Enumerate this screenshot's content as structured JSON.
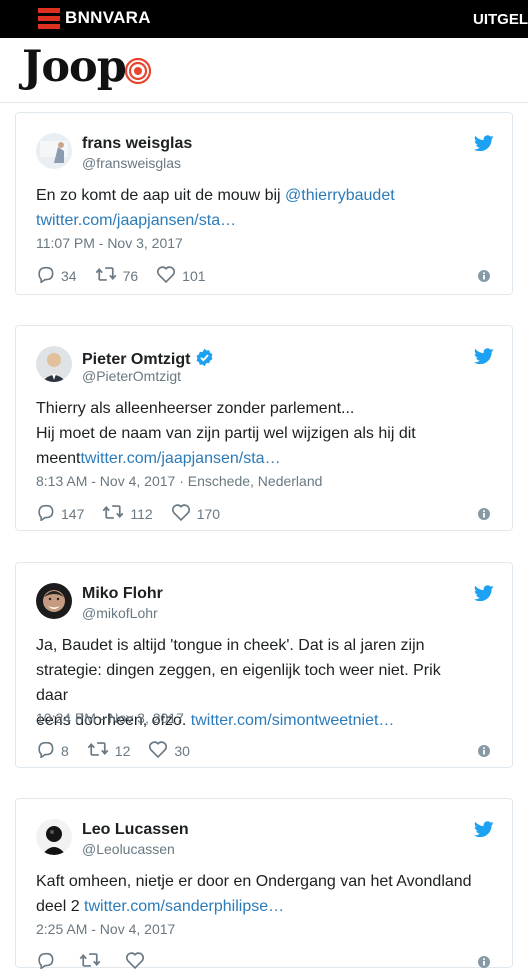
{
  "header": {
    "brand": "BNNVARA",
    "nav_label": "UITGELI",
    "site_logo": "Joop"
  },
  "tweets": [
    {
      "name": "frans weisglas",
      "handle": "@fransweisglas",
      "verified": false,
      "lines": [
        [
          {
            "t": "En zo komt de aap uit de mouw bij "
          },
          {
            "t": "@thierrybaudet",
            "link": true
          }
        ],
        [
          {
            "t": "twitter.com/jaapjansen/sta…",
            "link": true
          }
        ]
      ],
      "time": "11:07 PM - Nov 3, 2017",
      "replies": "34",
      "retweets": "76",
      "likes": "101"
    },
    {
      "name": "Pieter Omtzigt",
      "handle": "@PieterOmtzigt",
      "verified": true,
      "lines": [
        [
          {
            "t": "Thierry als alleenheerser zonder parlement..."
          }
        ],
        [
          {
            "t": "Hij moet de naam van zijn partij wel wijzigen als hij dit"
          }
        ],
        [
          {
            "t": "meent"
          },
          {
            "t": "twitter.com/jaapjansen/sta…",
            "link": true
          }
        ]
      ],
      "time": "8:13 AM - Nov 4, 2017 · Enschede, Nederland",
      "replies": "147",
      "retweets": "112",
      "likes": "170"
    },
    {
      "name": "Miko Flohr",
      "handle": "@mikofLohr",
      "verified": false,
      "lines": [
        [
          {
            "t": "Ja, Baudet is altijd 'tongue in cheek'. Dat is al jaren zijn"
          }
        ],
        [
          {
            "t": "strategie: dingen zeggen, en eigenlijk toch weer niet. Prik daar"
          }
        ],
        [
          {
            "t": "eens doorheen, ofzo. "
          },
          {
            "t": "twitter.com/simontweetniet…",
            "link": true
          }
        ]
      ],
      "time": "10:24 PM - Nov 3, 2017",
      "replies": "8",
      "retweets": "12",
      "likes": "30"
    },
    {
      "name": "Leo Lucassen",
      "handle": "@Leolucassen",
      "verified": false,
      "lines": [
        [
          {
            "t": "Kaft omheen, nietje er door en Ondergang van het Avondland"
          }
        ],
        [
          {
            "t": "deel 2 "
          },
          {
            "t": "twitter.com/sanderphilipse…",
            "link": true
          }
        ]
      ],
      "time": "2:25 AM - Nov 4, 2017",
      "replies": "",
      "retweets": "",
      "likes": ""
    }
  ],
  "colors": {
    "accent": "#1da1f2",
    "link": "#2b7bb9",
    "brand_red": "#e0301e",
    "muted": "#697882"
  },
  "icons": {
    "bird": "twitter-bird-icon",
    "verified": "verified-badge-icon",
    "reply": "reply-icon",
    "retweet": "retweet-icon",
    "like": "heart-icon",
    "info": "info-icon"
  }
}
